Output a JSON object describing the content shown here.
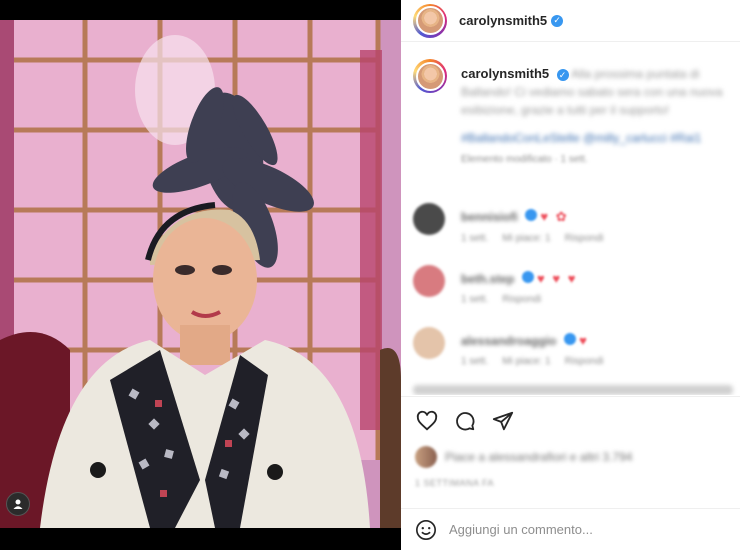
{
  "post": {
    "username": "carolynsmith5",
    "verified_badge": "✓",
    "caption": {
      "text": "Alla prossima puntata di Ballando! Ci vediamo sabato sera con una nuova esibizione, grazie a tutti per il supporto!",
      "hashtags": "#BallandoConLeStelle @milly_carlucci #Rai1",
      "meta": "Elemento modificato · 1 sett."
    }
  },
  "comments": [
    {
      "username": "bennisiofi",
      "emoji": "♥ ✿",
      "meta": [
        "1 sett.",
        "Mi piace: 1",
        "Rispondi"
      ]
    },
    {
      "username": "beth.step",
      "emoji": "♥ ♥ ♥",
      "meta": [
        "1 sett.",
        "Rispondi"
      ]
    },
    {
      "username": "alessandroaggio",
      "emoji": "♥",
      "meta": [
        "1 sett.",
        "Mi piace: 1",
        "Rispondi"
      ]
    }
  ],
  "likes_text": "Piace a alessandrafiori e altri 3.794",
  "date_text": "1 SETTIMANA FA",
  "add_comment": {
    "placeholder": "Aggiungi un commento..."
  },
  "icons": {
    "like": "heart-icon",
    "comment": "comment-icon",
    "share": "send-icon",
    "emoji": "emoji-icon"
  },
  "colors": {
    "verified": "#3897f0",
    "like_red": "#ed4956",
    "text": "#262626"
  }
}
